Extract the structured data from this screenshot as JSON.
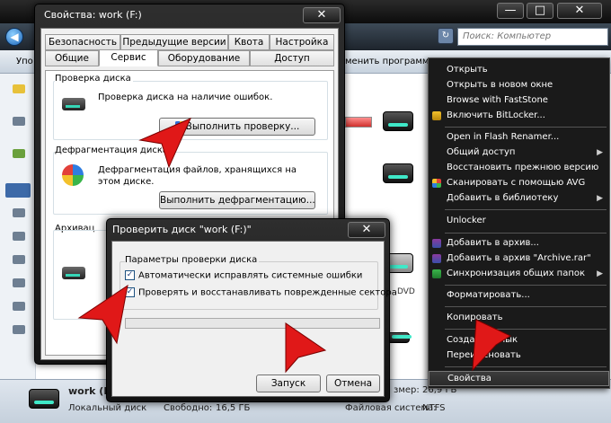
{
  "explorer": {
    "search_placeholder": "Поиск: Компьютер",
    "toolbar_left": "Упо",
    "toolbar_right": "менить программу",
    "status": {
      "drive_name": "work (F:)",
      "drive_type": "Локальный диск",
      "free_label": "Свободно:",
      "free_value": "16,5 ГБ",
      "fs_label": "Файловая система:",
      "fs_value": "NTFS",
      "size_label": "змер:",
      "size_value": "26,9 ГБ"
    },
    "dvd_label": "DVD"
  },
  "properties": {
    "title": "Свойства: work (F:)",
    "close_label": "✕",
    "tabs_top": [
      "Безопасность",
      "Предыдущие версии",
      "Квота",
      "Настройка"
    ],
    "tabs_bottom": [
      "Общие",
      "Сервис",
      "Оборудование",
      "Доступ"
    ],
    "check_group": "Проверка диска",
    "check_text": "Проверка диска на наличие ошибок.",
    "check_button": "Выполнить проверку...",
    "defrag_group": "Дефрагментация диска",
    "defrag_text": "Дефрагментация файлов, хранящихся на этом диске.",
    "defrag_button": "Выполнить дефрагментацию...",
    "archive_group": "Архивац"
  },
  "checkdisk": {
    "title": "Проверить диск \"work (F:)\"",
    "close_label": "✕",
    "options_group": "Параметры проверки диска",
    "option1": "Автоматически исправлять системные ошибки",
    "option1_checked": true,
    "option2": "Проверять и восстанавливать поврежденные сектора",
    "option2_checked": true,
    "start_button": "Запуск",
    "cancel_button": "Отмена"
  },
  "window_buttons": {
    "minimize": "—",
    "maximize": "□",
    "close": "✕"
  },
  "context_menu": {
    "items": [
      {
        "label": "Открыть",
        "icon": "",
        "submenu": false
      },
      {
        "label": "Открыть в новом окне",
        "icon": "",
        "submenu": false
      },
      {
        "label": "Browse with FastStone",
        "icon": "",
        "submenu": false
      },
      {
        "label": "Включить BitLocker...",
        "icon": "bitlocker-icon",
        "submenu": false
      },
      {
        "label": "Open in Flash Renamer...",
        "icon": "",
        "submenu": false
      },
      {
        "label": "Общий доступ",
        "icon": "",
        "submenu": true
      },
      {
        "label": "Восстановить прежнюю версию",
        "icon": "",
        "submenu": false
      },
      {
        "label": "Сканировать с помощью AVG",
        "icon": "avg-icon",
        "submenu": false
      },
      {
        "label": "Добавить в библиотеку",
        "icon": "",
        "submenu": true
      },
      {
        "label": "Unlocker",
        "icon": "",
        "submenu": false
      },
      {
        "label": "Добавить в архив...",
        "icon": "winrar-icon",
        "submenu": false
      },
      {
        "label": "Добавить в архив \"Archive.rar\"",
        "icon": "winrar-icon",
        "submenu": false
      },
      {
        "label": "Синхронизация общих папок",
        "icon": "sync-icon",
        "submenu": true
      },
      {
        "label": "Форматировать...",
        "icon": "",
        "submenu": false
      },
      {
        "label": "Копировать",
        "icon": "",
        "submenu": false
      },
      {
        "label": "Создать ярлык",
        "icon": "",
        "submenu": false
      },
      {
        "label": "Переименовать",
        "icon": "",
        "submenu": false
      },
      {
        "label": "Свойства",
        "icon": "",
        "submenu": false
      }
    ]
  },
  "colors": {
    "arrow": "#e01818",
    "highlight": "#3c3c3c",
    "drive_accent": "#3fe8c8",
    "usage_bar": "#d0312d"
  }
}
